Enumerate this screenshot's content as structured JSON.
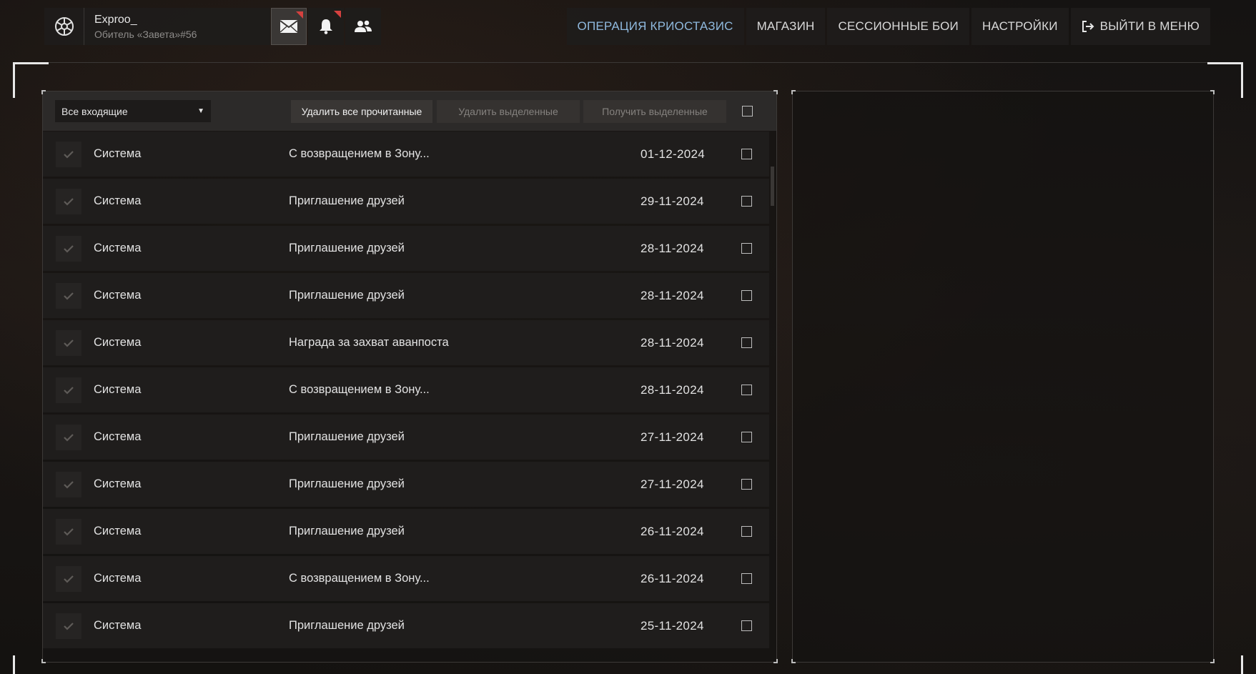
{
  "profile": {
    "nickname": "Exproo_",
    "subtitle": "Обитель «Завета»#56"
  },
  "header_icons": [
    "mail-icon",
    "bell-icon",
    "friends-icon"
  ],
  "nav": {
    "items": [
      {
        "label": "ОПЕРАЦИЯ КРИОСТАЗИС",
        "active": true
      },
      {
        "label": "МАГАЗИН",
        "active": false
      },
      {
        "label": "СЕССИОННЫЕ БОИ",
        "active": false
      },
      {
        "label": "НАСТРОЙКИ",
        "active": false
      },
      {
        "label": "ВЫЙТИ В МЕНЮ",
        "active": false
      }
    ]
  },
  "toolbar": {
    "filter_value": "Все входящие",
    "delete_read_label": "Удалить все прочитанные",
    "delete_selected_label": "Удалить выделенные",
    "claim_selected_label": "Получить выделенные"
  },
  "messages": [
    {
      "sender": "Система",
      "subject": "С возвращением в Зону...",
      "date": "01-12-2024"
    },
    {
      "sender": "Система",
      "subject": "Приглашение друзей",
      "date": "29-11-2024"
    },
    {
      "sender": "Система",
      "subject": "Приглашение друзей",
      "date": "28-11-2024"
    },
    {
      "sender": "Система",
      "subject": "Приглашение друзей",
      "date": "28-11-2024"
    },
    {
      "sender": "Система",
      "subject": "Награда за захват аванпоста",
      "date": "28-11-2024"
    },
    {
      "sender": "Система",
      "subject": "С возвращением в Зону...",
      "date": "28-11-2024"
    },
    {
      "sender": "Система",
      "subject": "Приглашение друзей",
      "date": "27-11-2024"
    },
    {
      "sender": "Система",
      "subject": "Приглашение друзей",
      "date": "27-11-2024"
    },
    {
      "sender": "Система",
      "subject": "Приглашение друзей",
      "date": "26-11-2024"
    },
    {
      "sender": "Система",
      "subject": "С возвращением в Зону...",
      "date": "26-11-2024"
    },
    {
      "sender": "Система",
      "subject": "Приглашение друзей",
      "date": "25-11-2024"
    }
  ],
  "colors": {
    "accent_active_nav": "#8fb9de",
    "notification": "#d5413f"
  }
}
